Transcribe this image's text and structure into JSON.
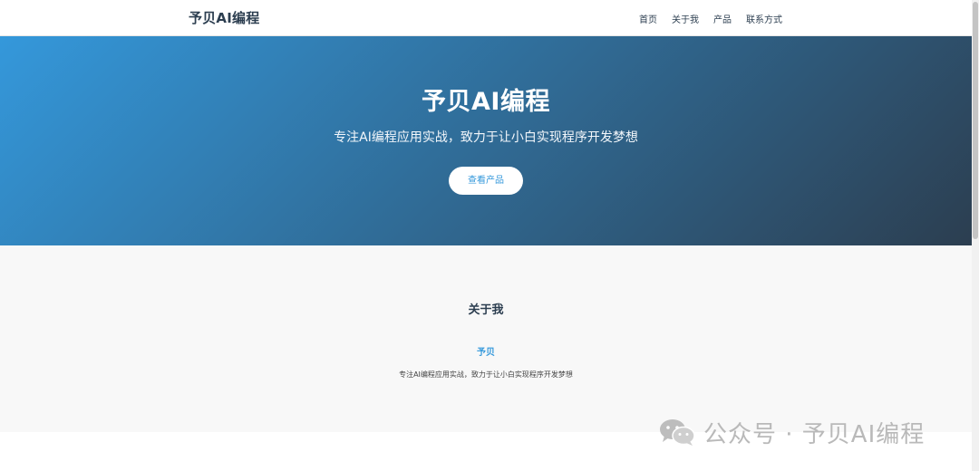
{
  "header": {
    "logo": "予贝AI编程",
    "nav": [
      "首页",
      "关于我",
      "产品",
      "联系方式"
    ]
  },
  "hero": {
    "title": "予贝AI编程",
    "subtitle": "专注AI编程应用实战，致力于让小白实现程序开发梦想",
    "button_label": "查看产品"
  },
  "about": {
    "title": "关于我",
    "name": "予贝",
    "description": "专注AI编程应用实战，致力于让小白实现程序开发梦想"
  },
  "watermark": {
    "text": "公众号 · 予贝AI编程",
    "icon": "wechat-icon"
  },
  "colors": {
    "accent": "#3498db",
    "dark": "#2c3e50",
    "hero_gradient_start": "#3498db",
    "hero_gradient_end": "#2c3e50"
  }
}
